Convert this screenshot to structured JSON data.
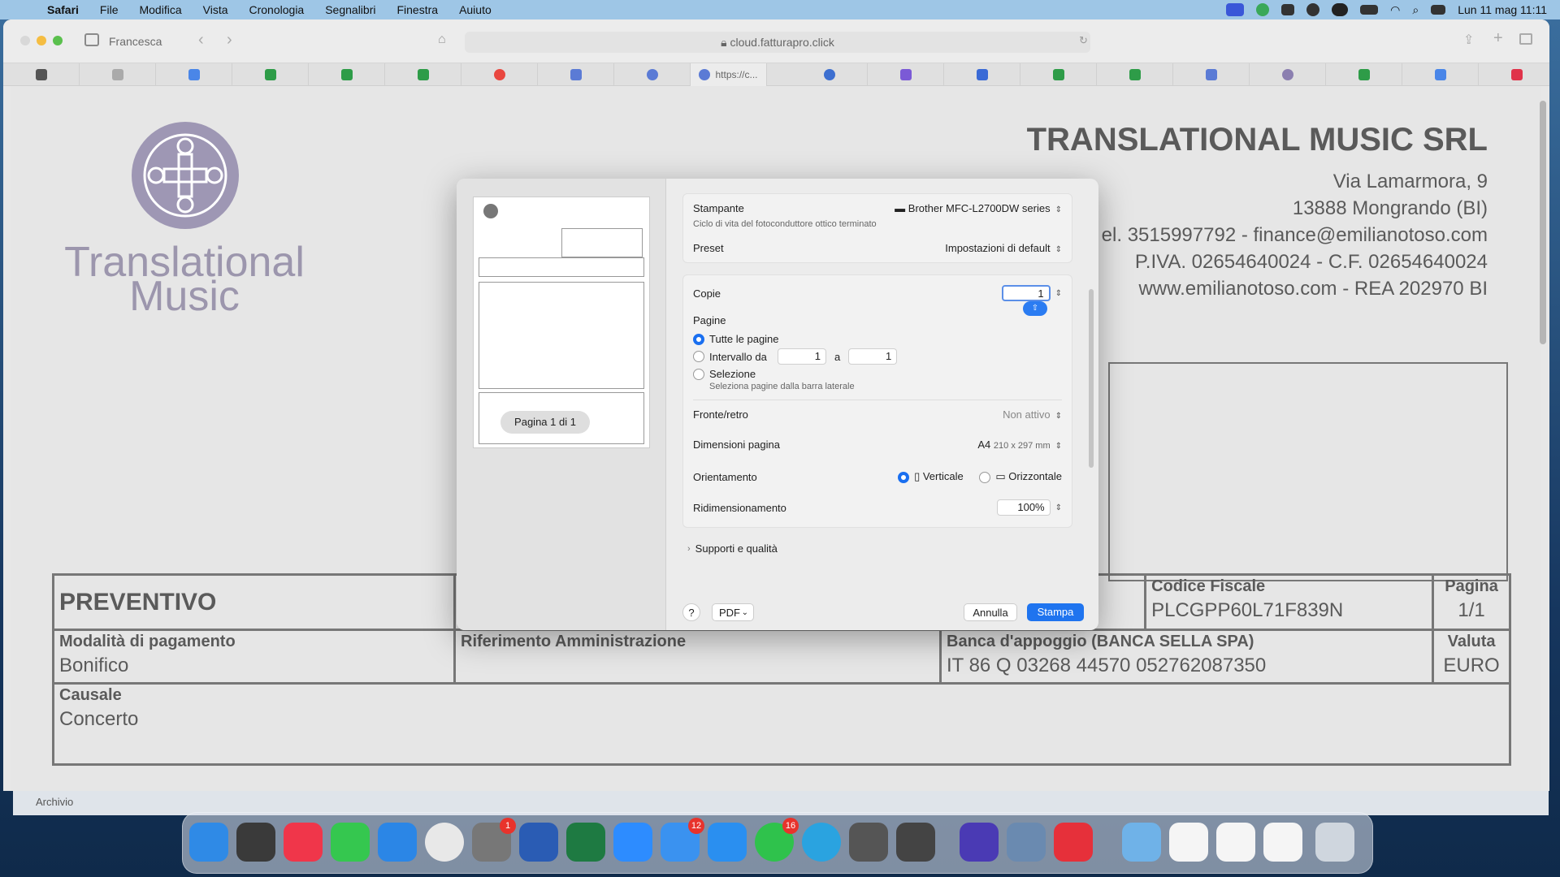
{
  "menubar": {
    "app": "Safari",
    "items": [
      "File",
      "Modifica",
      "Vista",
      "Cronologia",
      "Segnalibri",
      "Finestra",
      "Auiuto"
    ],
    "clock": "Lun 11 mag  11:11"
  },
  "browser": {
    "profile": "Francesca",
    "address": "cloud.fatturapro.click",
    "active_tab": "https://c..."
  },
  "document": {
    "logo_text": "Translational Music",
    "company": {
      "name": "TRANSLATIONAL MUSIC SRL",
      "address": "Via Lamarmora, 9",
      "city": "13888 Mongrando (BI)",
      "contact": "el. 3515997792 - finance@emilianotoso.com",
      "vat": "P.IVA. 02654640024 - C.F. 02654640024",
      "web": "www.emilianotoso.com - REA 202970 BI"
    },
    "table": {
      "title": "PREVENTIVO",
      "codice_fiscale_label": "Codice Fiscale",
      "codice_fiscale": "PLCGPP60L71F839N",
      "pagina_label": "Pagina",
      "pagina": "1/1",
      "modalita_label": "Modalità di pagamento",
      "modalita": "Bonifico",
      "riferimento_label": "Riferimento Amministrazione",
      "banca_label": "Banca d'appoggio (BANCA SELLA SPA)",
      "iban": "IT 86 Q 03268 44570 052762087350",
      "valuta_label": "Valuta",
      "valuta": "EURO",
      "causale_label": "Causale",
      "causale": "Concerto"
    },
    "archivio": "Archivio"
  },
  "print_dialog": {
    "page_pill": "Pagina 1 di 1",
    "printer_label": "Stampante",
    "printer_value": "Brother MFC-L2700DW series",
    "printer_note": "Ciclo di vita del fotoconduttore ottico terminato",
    "preset_label": "Preset",
    "preset_value": "Impostazioni di default",
    "copies_label": "Copie",
    "copies_value": "1",
    "pages_label": "Pagine",
    "all_pages": "Tutte le pagine",
    "range_label": "Intervallo da",
    "range_from": "1",
    "range_to_label": "a",
    "range_to": "1",
    "selection_label": "Selezione",
    "selection_note": "Seleziona pagine dalla barra laterale",
    "duplex_label": "Fronte/retro",
    "duplex_value": "Non attivo",
    "paper_label": "Dimensioni pagina",
    "paper_value": "A4",
    "paper_dims": "210 x 297 mm",
    "orientation_label": "Orientamento",
    "portrait": "Verticale",
    "landscape": "Orizzontale",
    "scale_label": "Ridimensionamento",
    "scale_value": "100%",
    "media_label": "Supporti e qualità",
    "help": "?",
    "pdf": "PDF",
    "cancel": "Annulla",
    "print": "Stampa"
  },
  "dock": {
    "badges": {
      "settings": "1",
      "mail": "12",
      "whatsapp": "16"
    }
  }
}
